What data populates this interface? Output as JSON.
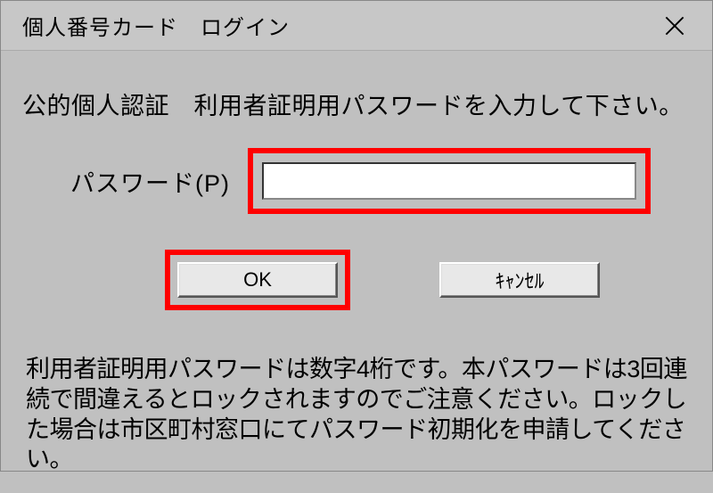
{
  "titlebar": {
    "title": "個人番号カード　ログイン"
  },
  "dialog": {
    "instruction": "公的個人認証　利用者証明用パスワードを入力して下さい。",
    "password_label": "パスワード(P)",
    "password_value": "",
    "ok_label": "OK",
    "cancel_label": "ｷｬﾝｾﾙ",
    "note": "利用者証明用パスワードは数字4桁です。本パスワードは3回連続で間違えるとロックされますのでご注意ください。ロックした場合は市区町村窓口にてパスワード初期化を申請してください。"
  }
}
